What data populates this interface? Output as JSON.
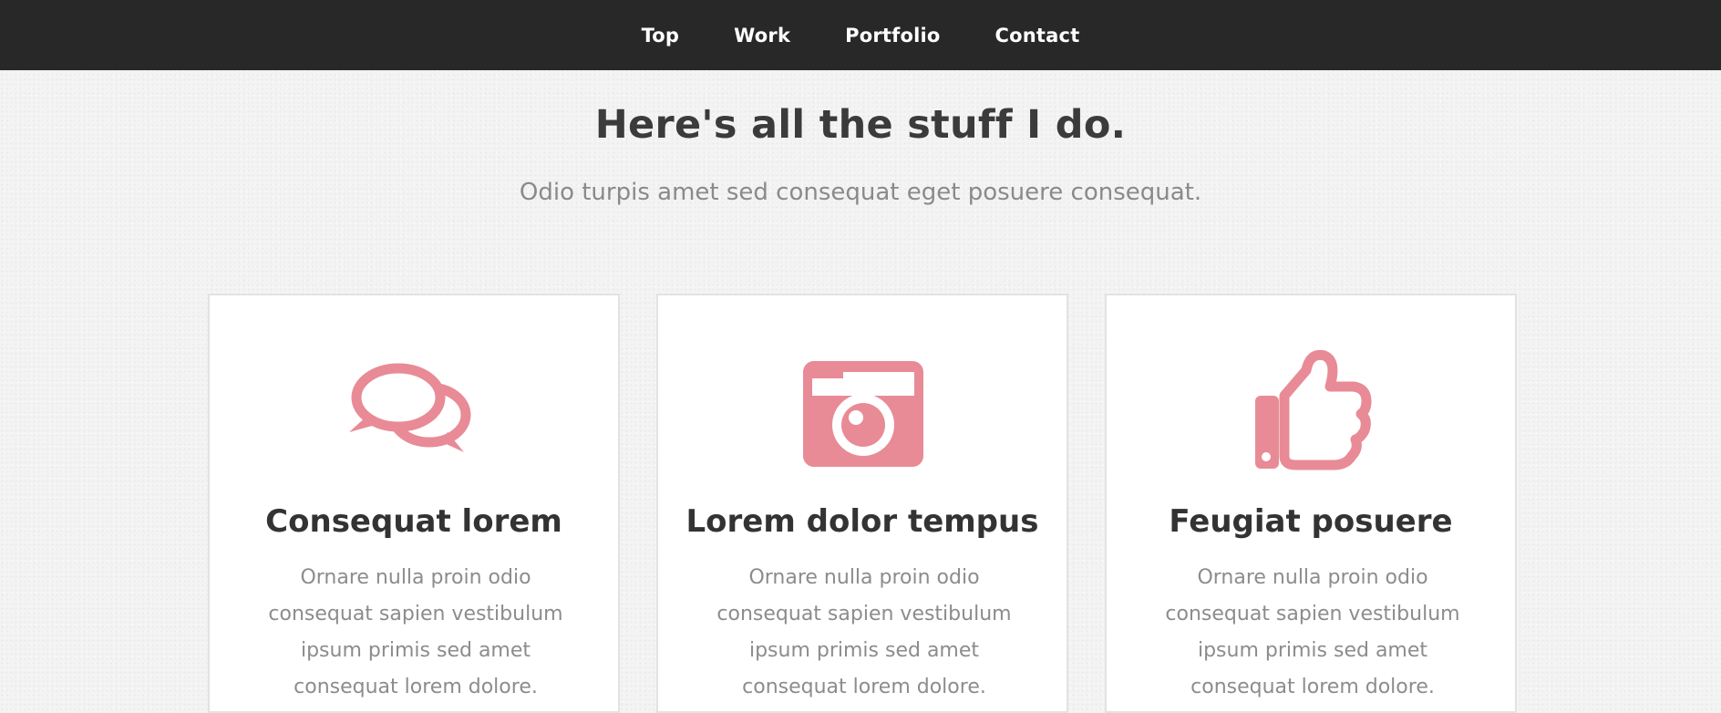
{
  "nav": {
    "items": [
      {
        "label": "Top"
      },
      {
        "label": "Work"
      },
      {
        "label": "Portfolio"
      },
      {
        "label": "Contact"
      }
    ]
  },
  "hero": {
    "title": "Here's all the stuff I do.",
    "subtitle": "Odio turpis amet sed consequat eget posuere consequat."
  },
  "cards": [
    {
      "icon": "chat-bubbles-icon",
      "title": "Consequat lorem",
      "description": "Ornare nulla proin odio consequat sapien vestibulum ipsum primis sed amet consequat lorem dolore."
    },
    {
      "icon": "camera-icon",
      "title": "Lorem dolor tempus",
      "description": "Ornare nulla proin odio consequat sapien vestibulum ipsum primis sed amet consequat lorem dolore."
    },
    {
      "icon": "thumbs-up-icon",
      "title": "Feugiat posuere",
      "description": "Ornare nulla proin odio consequat sapien vestibulum ipsum primis sed amet consequat lorem dolore."
    }
  ],
  "colors": {
    "accent": "#e88b96",
    "nav_bg": "#282828",
    "heading": "#3b3b3b",
    "muted_text": "#8c8c8c"
  }
}
